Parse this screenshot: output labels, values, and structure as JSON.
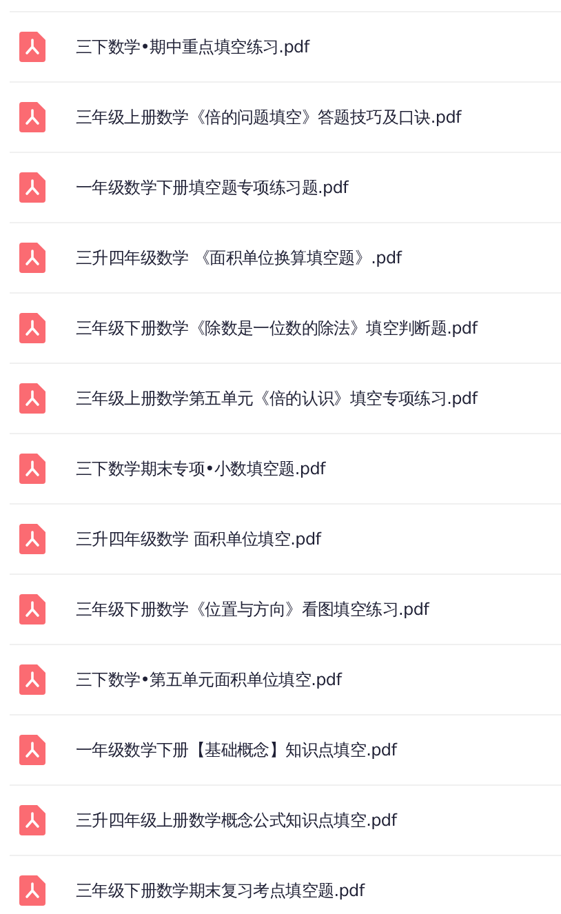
{
  "files": [
    {
      "name": "三下数学•期中重点填空练习.pdf"
    },
    {
      "name": "三年级上册数学《倍的问题填空》答题技巧及口诀.pdf"
    },
    {
      "name": "一年级数学下册填空题专项练习题.pdf"
    },
    {
      "name": "三升四年级数学 《面积单位换算填空题》.pdf"
    },
    {
      "name": "三年级下册数学《除数是一位数的除法》填空判断题.pdf"
    },
    {
      "name": "三年级上册数学第五单元《倍的认识》填空专项练习.pdf"
    },
    {
      "name": "三下数学期末专项•小数填空题.pdf"
    },
    {
      "name": "三升四年级数学 面积单位填空.pdf"
    },
    {
      "name": "三年级下册数学《位置与方向》看图填空练习.pdf"
    },
    {
      "name": "三下数学•第五单元面积单位填空.pdf"
    },
    {
      "name": "一年级数学下册【基础概念】知识点填空.pdf"
    },
    {
      "name": "三升四年级上册数学概念公式知识点填空.pdf"
    },
    {
      "name": "三年级下册数学期末复习考点填空题.pdf"
    }
  ]
}
